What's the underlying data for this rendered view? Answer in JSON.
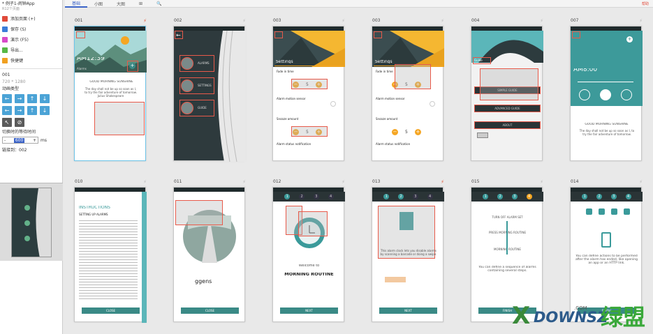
{
  "project": {
    "title": "* 例子1-闹钟App",
    "size": "R12个页面"
  },
  "menu": [
    {
      "label": "添加页面 (+)",
      "icon": "add-page-icon",
      "color": "#e04a3a"
    },
    {
      "label": "保存 (S)",
      "icon": "save-icon",
      "color": "#3b7dd8"
    },
    {
      "label": "演示 (F5)",
      "icon": "play-icon",
      "color": "#d84ac8"
    },
    {
      "label": "导出...",
      "icon": "export-icon",
      "color": "#57b846"
    },
    {
      "label": "快捷键",
      "icon": "keyboard-icon",
      "color": "#f0a020"
    }
  ],
  "page": {
    "id": "001",
    "size": "720 * 1280"
  },
  "anim": {
    "label": "动画类型",
    "arrows": [
      "←",
      "→",
      "↑",
      "↓",
      "←",
      "→",
      "↑",
      "↓",
      "↖",
      "⊘"
    ]
  },
  "duration": {
    "label": "切换时的等待时间",
    "value": "600",
    "unit": "ms",
    "minus": "-",
    "plus": "+"
  },
  "link": {
    "label": "链接到：002"
  },
  "tabs": [
    {
      "label": "基础"
    },
    {
      "label": "小图"
    },
    {
      "label": "大图"
    },
    {
      "label": "⊞"
    },
    {
      "label": "🔍"
    }
  ],
  "topright": "帮助",
  "screens": [
    {
      "id": "001",
      "title": "AM12:39",
      "sub": "Alarms",
      "greet": "GOOD MORNING SUNSHINE",
      "body": "The day shall not be up so soon as I, to try the fair adventure of tomorrow. Julius Shakespeare"
    },
    {
      "id": "002",
      "items": [
        "ALARMS",
        "SETTINGS",
        "GUIDE"
      ]
    },
    {
      "id": "003",
      "title": "Settings",
      "fade": "Fade in time",
      "val": "5",
      "motion": "Alarm motion sensor",
      "snooze": "Snooze amount",
      "status": "Alarm status notification"
    },
    {
      "id": "003",
      "title": "Settings",
      "fade": "Fade in time",
      "val": "5",
      "motion": "Alarm motion sensor",
      "snooze": "Snooze amount",
      "status": "Alarm status notification"
    },
    {
      "id": "004",
      "title": "Guide",
      "b1": "SIMPLE GUIDE",
      "b2": "ADVANCED GUIDE",
      "b3": "ABOUT"
    },
    {
      "id": "007",
      "title": "AM8:00",
      "greet": "GOOD MORNING SUNSHINE",
      "body": "The day shall not be up so soon as I, to try the fair adventure of tomorrow."
    },
    {
      "id": "010",
      "title": "INSTRUCTIONS",
      "sub": "SETTING UP ALARMS",
      "btn": "CLOSE"
    },
    {
      "id": "011",
      "brand": "ggens",
      "btn": "CLOSE"
    },
    {
      "id": "012",
      "welcome": "Welcome to",
      "name": "MORNING ROUTINE",
      "btn": "NEXT"
    },
    {
      "id": "013",
      "body": "This alarm clock lets you disable alarms by scanning a barcode or doing a swipe.",
      "btn": "NEXT"
    },
    {
      "id": "015",
      "l1": "TURN OFF ALARM SET",
      "l2": "PRESS MORNING ROUTINE",
      "l3": "MORNING ROUTINE",
      "body": "You can define a sequence of alarms containing several steps.",
      "btn": "FINISH"
    },
    {
      "id": "014",
      "body": "You can define actions to be performed after the alarm has ended, like opening an app or an HTTP link.",
      "btn": "FINISH"
    }
  ],
  "watermark": {
    "text": "DOWNSZ",
    "cn": "绿盟",
    "dom": ".COM"
  }
}
